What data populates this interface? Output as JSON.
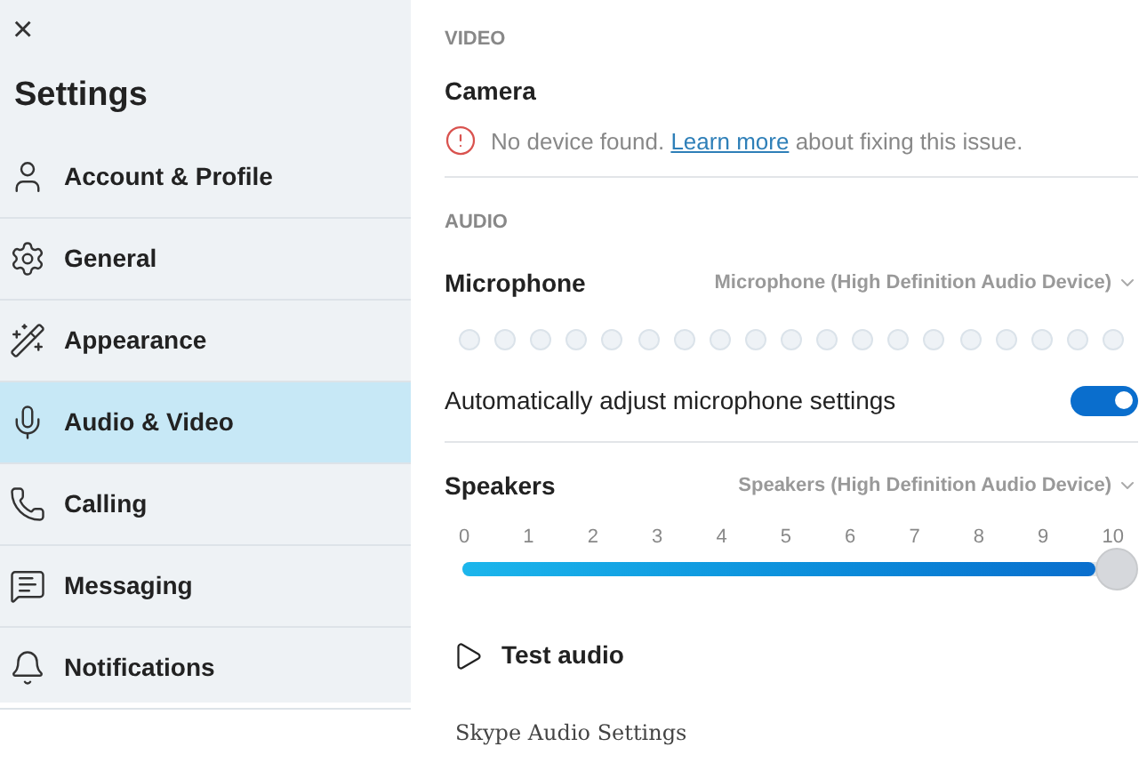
{
  "sidebar": {
    "close": "×",
    "title": "Settings",
    "items": [
      {
        "label": "Account & Profile",
        "selected": false
      },
      {
        "label": "General",
        "selected": false
      },
      {
        "label": "Appearance",
        "selected": false
      },
      {
        "label": "Audio & Video",
        "selected": true
      },
      {
        "label": "Calling",
        "selected": false
      },
      {
        "label": "Messaging",
        "selected": false
      },
      {
        "label": "Notifications",
        "selected": false
      }
    ]
  },
  "video": {
    "heading": "VIDEO",
    "camera_label": "Camera",
    "warning": {
      "before": "No device found.",
      "link": "Learn more",
      "after": "about fixing this issue."
    }
  },
  "audio": {
    "heading": "AUDIO",
    "microphone": {
      "label": "Microphone",
      "device": "Microphone (High Definition Audio Device)"
    },
    "auto_adjust": {
      "label": "Automatically adjust microphone settings",
      "on": true
    },
    "speakers": {
      "label": "Speakers",
      "device": "Speakers (High Definition Audio Device)",
      "ticks": [
        "0",
        "1",
        "2",
        "3",
        "4",
        "5",
        "6",
        "7",
        "8",
        "9",
        "10"
      ],
      "level": 1
    },
    "test_audio": "Test audio"
  },
  "caption": "Skype Audio Settings"
}
